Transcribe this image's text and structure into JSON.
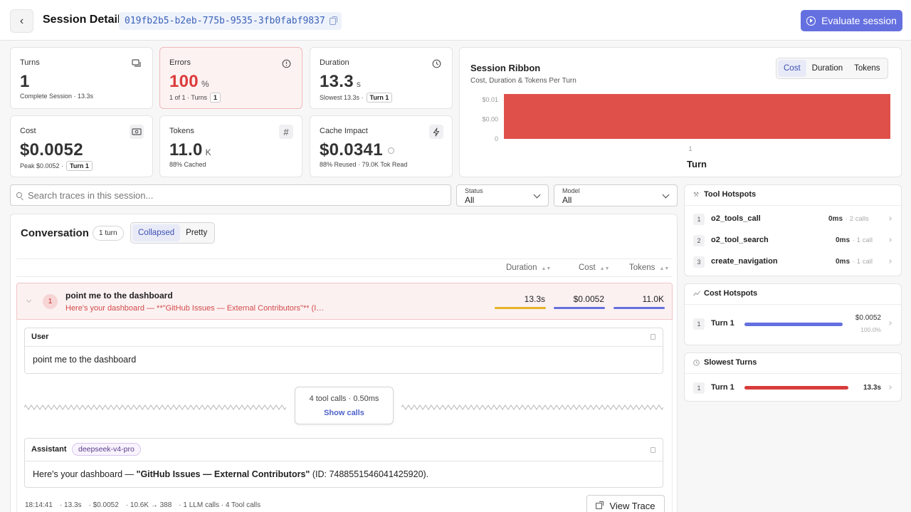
{
  "header": {
    "title": "Session Detail",
    "session_id": "019fb2b5-b2eb-775b-9535-3fb0fabf9837",
    "evaluate_label": "Evaluate session",
    "accent": "#6570e0"
  },
  "stats": {
    "turns": {
      "label": "Turns",
      "value": "1",
      "sub": "Complete Session · 13.3s"
    },
    "errors": {
      "label": "Errors",
      "value": "100",
      "unit": "%",
      "sub": "1 of 1 · Turns",
      "chip": "1"
    },
    "duration": {
      "label": "Duration",
      "value": "13.3",
      "unit": "s",
      "sub": "Slowest 13.3s ·",
      "chip": "Turn 1"
    },
    "cost": {
      "label": "Cost",
      "value": "$0.0052",
      "sub": "Peak $0.0052 ·",
      "chip": "Turn 1"
    },
    "tokens": {
      "label": "Tokens",
      "value": "11.0",
      "unit": "K",
      "sub": "88% Cached"
    },
    "cache": {
      "label": "Cache Impact",
      "value": "$0.0341",
      "sub": "88% Reused · 79.0K Tok Read"
    }
  },
  "ribbon": {
    "title": "Session Ribbon",
    "subtitle": "Cost, Duration & Tokens Per Turn",
    "tabs": [
      "Cost",
      "Duration",
      "Tokens"
    ],
    "active_tab": "Cost"
  },
  "chart_data": {
    "type": "bar",
    "categories": [
      "1"
    ],
    "values": [
      0.0052
    ],
    "xlabel": "Turn",
    "ylabel": "",
    "ytick_labels": [
      "$0.01",
      "$0.00",
      "0"
    ],
    "ylim": [
      0,
      0.0052
    ],
    "bar_color": "#e0504a"
  },
  "search": {
    "placeholder": "Search traces in this session..."
  },
  "filters": {
    "status": {
      "label": "Status",
      "value": "All"
    },
    "model": {
      "label": "Model",
      "value": "All"
    }
  },
  "conversation": {
    "title": "Conversation",
    "turn_count": "1 turn",
    "views": [
      "Collapsed",
      "Pretty"
    ],
    "active_view": "Collapsed",
    "columns": [
      "Duration",
      "Cost",
      "Tokens"
    ],
    "turn": {
      "number": "1",
      "question": "point me to the dashboard",
      "answer_preview": "Here's your dashboard — **\"GitHub Issues — External Contributors\"** (ID:...",
      "duration": "13.3s",
      "cost": "$0.0052",
      "tokens": "11.0K"
    },
    "user": {
      "role": "User",
      "text": "point me to the dashboard"
    },
    "tools": {
      "summary": "4 tool calls · 0.50ms",
      "show_label": "Show calls"
    },
    "assistant": {
      "role": "Assistant",
      "model": "deepseek-v4-pro",
      "text_prefix": "Here's your dashboard — ",
      "text_bold": "\"GitHub Issues — External Contributors\"",
      "text_suffix": " (ID: 7488551546041425920)."
    },
    "footer": {
      "time": "18:14:41",
      "duration": "· 13.3s",
      "cost": "· $0.0052",
      "tokens": "· 10.6K → 388",
      "calls": "· 1 LLM calls · 4 Tool calls"
    },
    "view_trace_label": "View Trace"
  },
  "tool_hotspots": {
    "title": "Tool Hotspots",
    "items": [
      {
        "rank": "1",
        "name": "o2_tools_call",
        "ms": "0ms",
        "calls": "· 2 calls"
      },
      {
        "rank": "2",
        "name": "o2_tool_search",
        "ms": "0ms",
        "calls": "· 1 call"
      },
      {
        "rank": "3",
        "name": "create_navigation",
        "ms": "0ms",
        "calls": "· 1 call"
      }
    ]
  },
  "cost_hotspots": {
    "title": "Cost Hotspots",
    "items": [
      {
        "rank": "1",
        "name": "Turn 1",
        "value": "$0.0052",
        "pct": "100.0%",
        "fraction": 1.0
      }
    ]
  },
  "slowest_turns": {
    "title": "Slowest Turns",
    "items": [
      {
        "rank": "1",
        "name": "Turn 1",
        "value": "13.3s",
        "fraction": 1.0
      }
    ]
  }
}
